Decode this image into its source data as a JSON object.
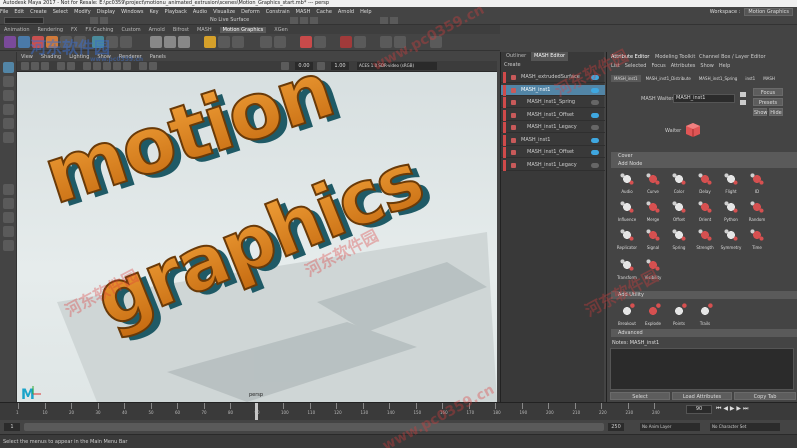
{
  "window": {
    "title": "Autodesk Maya 2017 - Not for Resale: E:\\pc0359\\project\\motionu_animated_extrusion\\scenes\\Motion_Graphics_start.mb* --- persp"
  },
  "menubar": [
    "File",
    "Edit",
    "Create",
    "Select",
    "Modify",
    "Display",
    "Windows",
    "Key",
    "Playback",
    "Audio",
    "Visualize",
    "Deform",
    "Constrain",
    "MASH",
    "Cache",
    "Arnold",
    "Help"
  ],
  "workspace": {
    "label": "Workspace :",
    "value": "Motion Graphics"
  },
  "status": {
    "no_live": "No Live Surface"
  },
  "shelf_tabs": [
    "Animation",
    "Rendering",
    "FX",
    "FX Caching",
    "Custom",
    "Arnold",
    "Bifrost",
    "MASH",
    "Motion Graphics",
    "XGen"
  ],
  "shelf_active": "Motion Graphics",
  "viewport": {
    "menu": [
      "View",
      "Shading",
      "Lighting",
      "Show",
      "Renderer",
      "Panels"
    ],
    "exposure": "0.00",
    "gamma": "1.00",
    "color_space": "ACES 1.0 SDR-video (sRGB)",
    "camera": "persp",
    "logo": "M",
    "bg_top": "#d7dfe0",
    "text_color": "#e08a1e",
    "shadow_color": "#1f5a66"
  },
  "outliner": {
    "tabs": [
      "Outliner",
      "MASH Editor"
    ],
    "create": "Create",
    "rows": [
      {
        "label": "MASH_extrudedSurface",
        "color": "#d04a4a",
        "toggle": true,
        "selected": false
      },
      {
        "label": "MASH_inst1",
        "color": "#d04a4a",
        "toggle": true,
        "selected": true
      },
      {
        "label": "MASH_inst1_Spring",
        "color": "#d04a4a",
        "toggle": false,
        "selected": false
      },
      {
        "label": "MASH_inst1_Offset",
        "color": "#d04a4a",
        "toggle": true,
        "selected": false
      },
      {
        "label": "MASH_inst1_Legacy",
        "color": "#d04a4a",
        "toggle": false,
        "selected": false
      },
      {
        "label": "MASH_inst1",
        "color": "#d04a4a",
        "toggle": true,
        "selected": false
      },
      {
        "label": "MASH_inst1_Offset",
        "color": "#d04a4a",
        "toggle": true,
        "selected": false
      },
      {
        "label": "MASH_inst1_Legacy",
        "color": "#d04a4a",
        "toggle": false,
        "selected": false
      }
    ]
  },
  "attr": {
    "tabs": [
      "Attribute Editor",
      "Modeling Toolkit",
      "Channel Box / Layer Editor"
    ],
    "menu": [
      "List",
      "Selected",
      "Focus",
      "Attributes",
      "Show",
      "Help"
    ],
    "node_tabs": [
      "MASH_inst1",
      "MASH_inst1_Distribute",
      "MASH_inst1_Spring",
      "inst1",
      "MASH"
    ],
    "node_label": "MASH Waiter:",
    "node_value": "MASH_inst1",
    "focus": "Focus",
    "presets": "Presets",
    "show": "Show",
    "hide": "Hide",
    "waiter": "Waiter",
    "sections": {
      "cover": "Cover",
      "add_node": "Add Node",
      "add_utility": "Add Utility",
      "advanced": "Advanced"
    },
    "nodes_row1": [
      "Audio",
      "Curve",
      "Color",
      "Delay",
      "Flight",
      "ID"
    ],
    "nodes_row2": [
      "Influence",
      "Merge",
      "Offset",
      "Orient",
      "Python",
      "Random"
    ],
    "nodes_row3": [
      "Replicator",
      "Signal",
      "Spring",
      "Strength",
      "Symmetry",
      "Time"
    ],
    "nodes_row4": [
      "Transform",
      "Visibility"
    ],
    "utils": [
      "Breakout",
      "Explode",
      "Points",
      "Trails"
    ],
    "notes_label": "Notes:",
    "notes_value": "MASH_inst1",
    "select_btn": "Select",
    "load_btn": "Load Attributes",
    "copy_btn": "Copy Tab"
  },
  "timeline": {
    "ticks": [
      "1",
      "10",
      "20",
      "30",
      "40",
      "50",
      "60",
      "70",
      "80",
      "90",
      "100",
      "110",
      "120",
      "130",
      "140",
      "150",
      "160",
      "170",
      "180",
      "190",
      "200",
      "210",
      "220",
      "230",
      "240"
    ],
    "current": "90",
    "range_start": "1",
    "range_end": "250",
    "anim_layer": "No Anim Layer",
    "char_set": "No Character Set"
  },
  "help_line": "Select the menus to appear in the Main Menu Bar",
  "watermark": {
    "cn": "河东软件园",
    "url": "www.pc0359.cn"
  }
}
